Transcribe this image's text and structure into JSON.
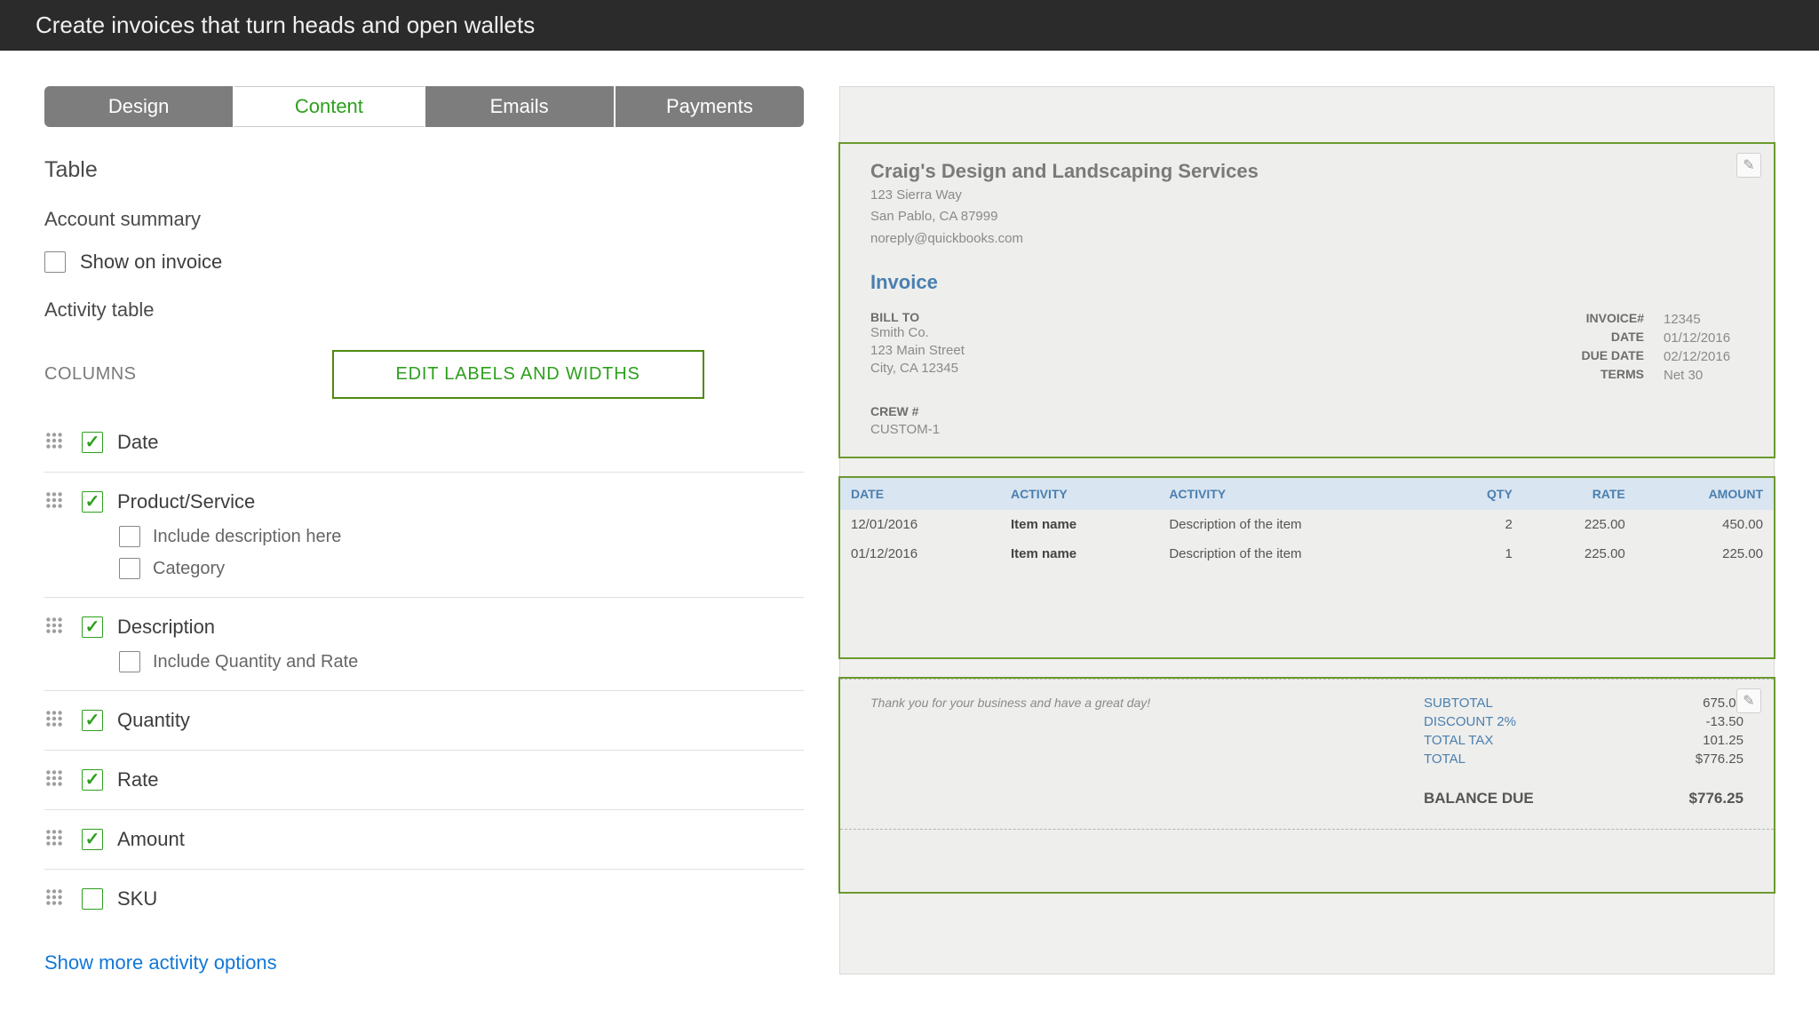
{
  "banner": {
    "title": "Create invoices that turn heads and open wallets"
  },
  "tabs": [
    {
      "id": "design",
      "label": "Design",
      "active": false
    },
    {
      "id": "content",
      "label": "Content",
      "active": true
    },
    {
      "id": "emails",
      "label": "Emails",
      "active": false
    },
    {
      "id": "payments",
      "label": "Payments",
      "active": false
    }
  ],
  "settings": {
    "table_heading": "Table",
    "account_summary_heading": "Account summary",
    "show_on_invoice_label": "Show on invoice",
    "activity_table_heading": "Activity table",
    "columns_label": "COLUMNS",
    "edit_labels_button": "EDIT LABELS AND WIDTHS",
    "more_link": "Show more activity options",
    "columns": [
      {
        "id": "date",
        "label": "Date",
        "checked": true
      },
      {
        "id": "product",
        "label": "Product/Service",
        "checked": true,
        "sub": [
          {
            "id": "inc_desc_here",
            "label": "Include description here",
            "checked": false
          },
          {
            "id": "category",
            "label": "Category",
            "checked": false
          }
        ]
      },
      {
        "id": "description",
        "label": "Description",
        "checked": true,
        "sub": [
          {
            "id": "inc_qty_rate",
            "label": "Include Quantity and Rate",
            "checked": false
          }
        ]
      },
      {
        "id": "quantity",
        "label": "Quantity",
        "checked": true
      },
      {
        "id": "rate",
        "label": "Rate",
        "checked": true
      },
      {
        "id": "amount",
        "label": "Amount",
        "checked": true
      },
      {
        "id": "sku",
        "label": "SKU",
        "checked": false
      }
    ]
  },
  "preview": {
    "company": {
      "name": "Craig's Design and Landscaping Services",
      "addr1": "123 Sierra Way",
      "addr2": "San Pablo, CA 87999",
      "email": "noreply@quickbooks.com"
    },
    "doc_title": "Invoice",
    "bill_to": {
      "heading": "BILL TO",
      "name": "Smith Co.",
      "addr1": "123 Main Street",
      "addr2": "City, CA 12345"
    },
    "meta": {
      "invoice_num_label": "INVOICE#",
      "invoice_num": "12345",
      "date_label": "DATE",
      "date": "01/12/2016",
      "due_label": "DUE DATE",
      "due": "02/12/2016",
      "terms_label": "TERMS",
      "terms": "Net 30"
    },
    "crew": {
      "heading": "CREW #",
      "value": "CUSTOM-1"
    },
    "table": {
      "headers": {
        "date": "DATE",
        "activity1": "ACTIVITY",
        "activity2": "ACTIVITY",
        "qty": "QTY",
        "rate": "RATE",
        "amount": "AMOUNT"
      },
      "rows": [
        {
          "date": "12/01/2016",
          "item": "Item name",
          "desc": "Description of the item",
          "qty": "2",
          "rate": "225.00",
          "amount": "450.00"
        },
        {
          "date": "01/12/2016",
          "item": "Item name",
          "desc": "Description of the item",
          "qty": "1",
          "rate": "225.00",
          "amount": "225.00"
        }
      ]
    },
    "footer": {
      "thanks": "Thank you for your business and have a great day!",
      "lines": [
        {
          "label": "SUBTOTAL",
          "value": "675.00"
        },
        {
          "label": "DISCOUNT 2%",
          "value": "-13.50"
        },
        {
          "label": "TOTAL TAX",
          "value": "101.25"
        },
        {
          "label": "TOTAL",
          "value": "$776.25"
        }
      ],
      "balance_label": "BALANCE DUE",
      "balance_value": "$776.25"
    }
  }
}
